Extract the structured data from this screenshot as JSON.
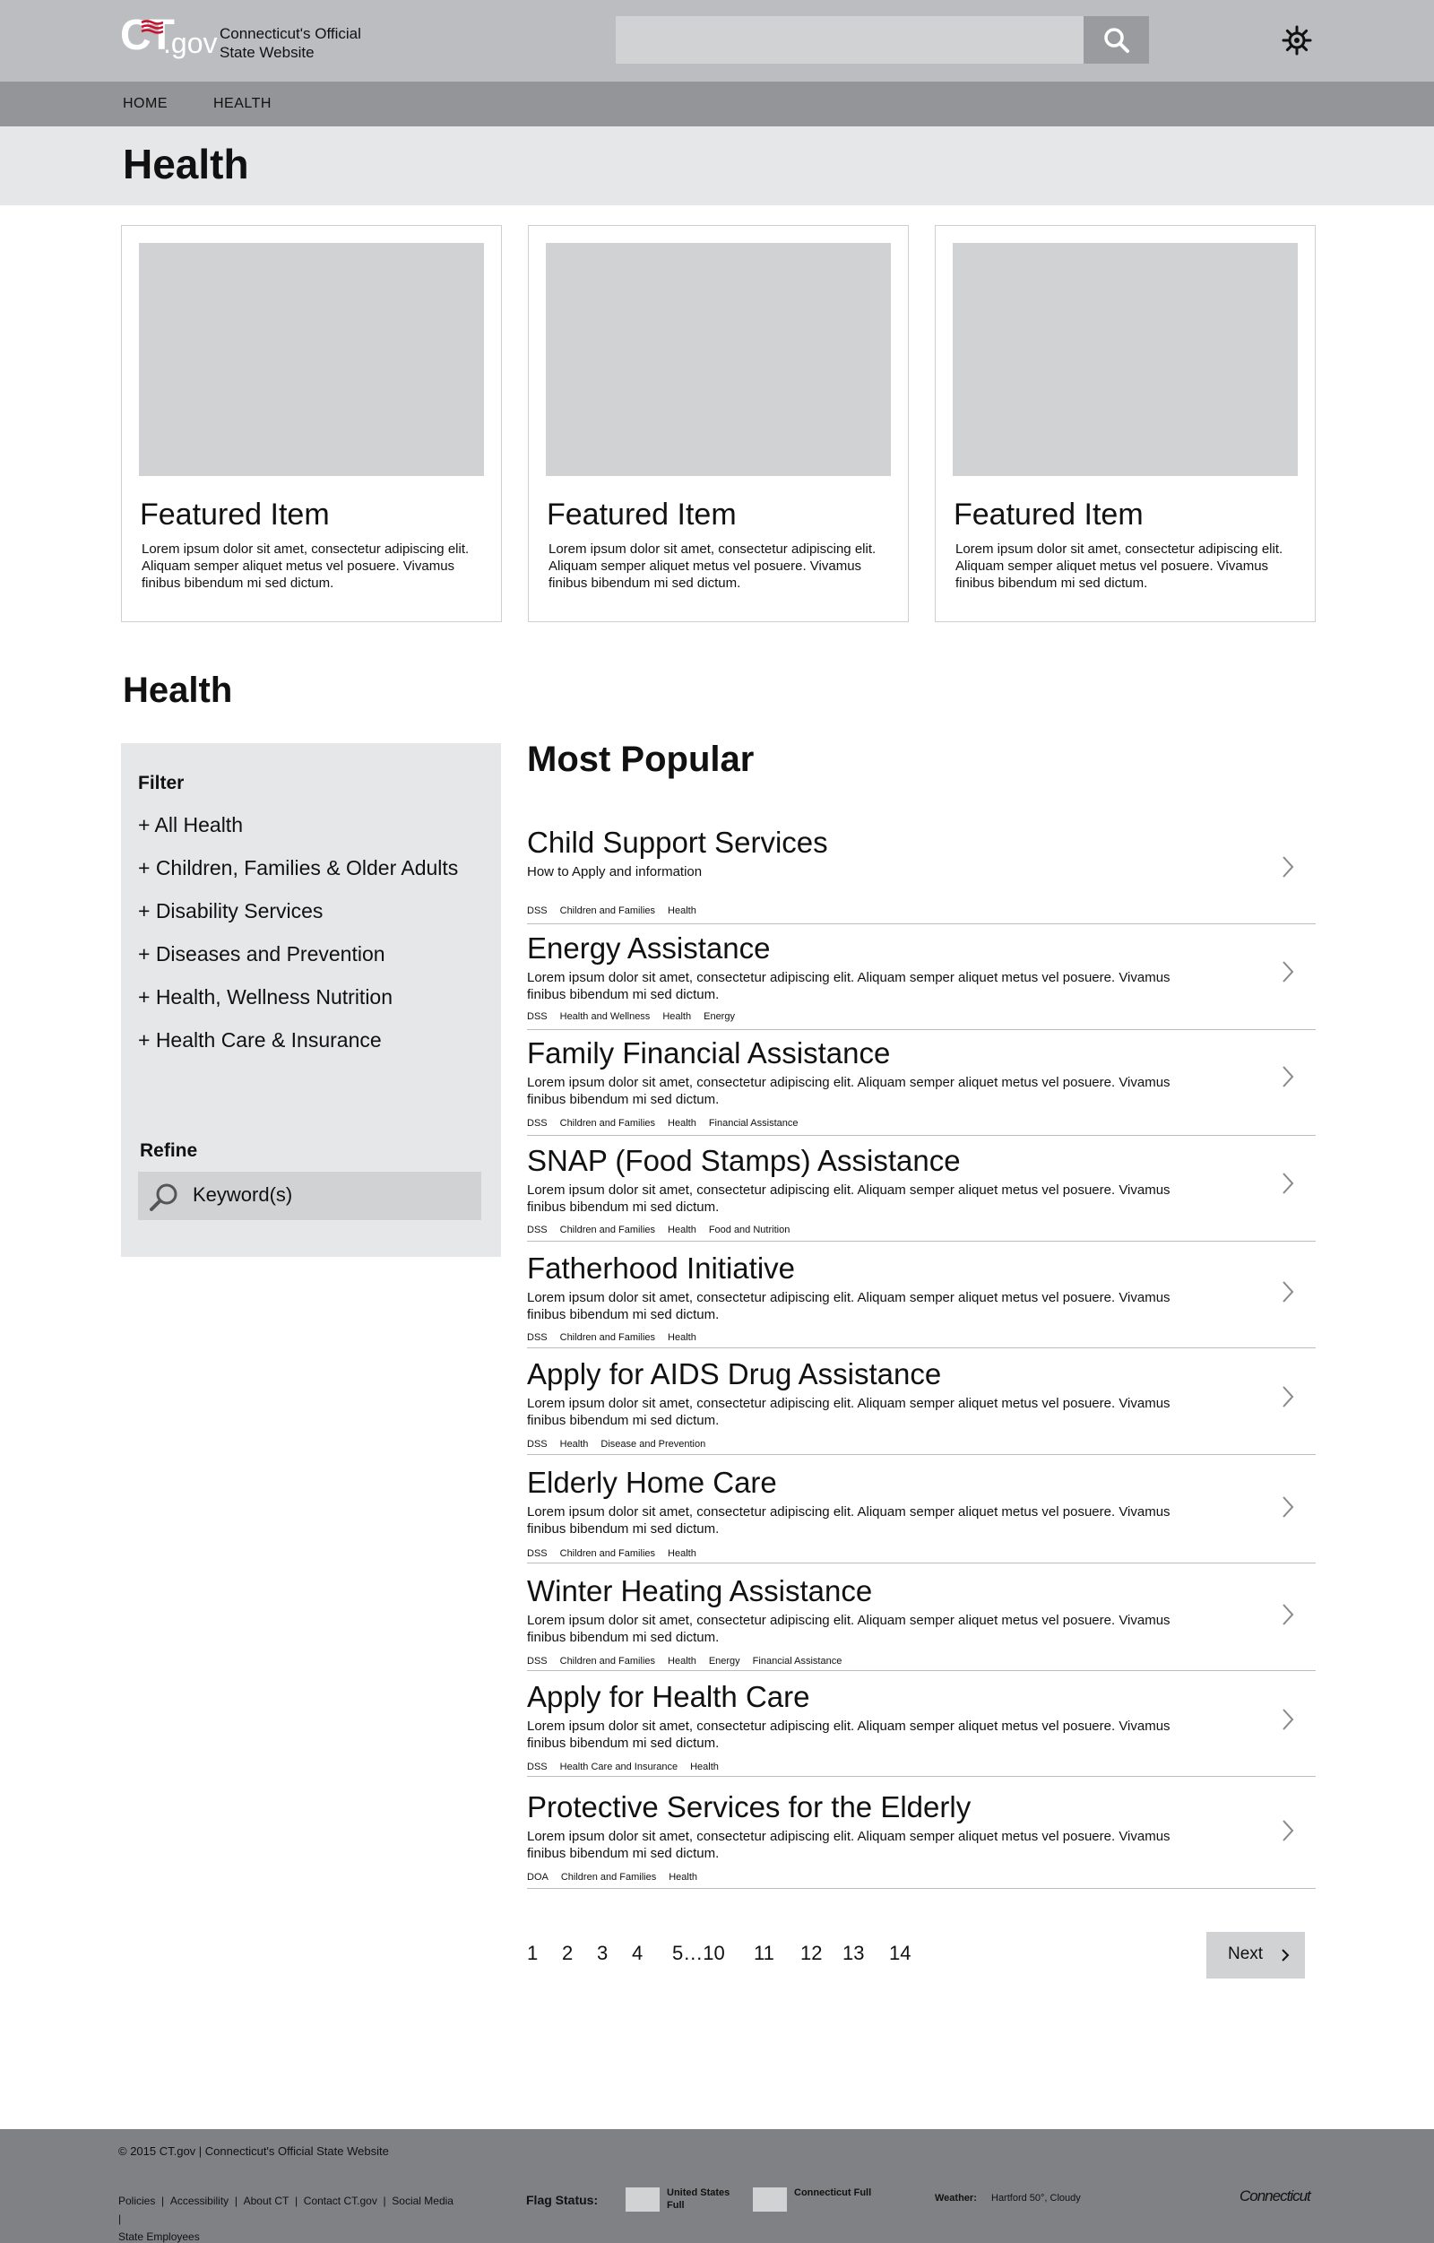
{
  "header": {
    "logo_ct": "CT",
    "logo_gov": ".gov",
    "site_title_line1": "Connecticut's Official",
    "site_title_line2": "State Website",
    "search_placeholder": ""
  },
  "nav": {
    "items": [
      "HOME",
      "HEALTH"
    ]
  },
  "page_title": "Health",
  "featured": [
    {
      "title": "Featured Item",
      "desc": "Lorem ipsum dolor sit amet, consectetur adipiscing elit. Aliquam semper aliquet metus vel posuere. Vivamus finibus bibendum mi sed dictum."
    },
    {
      "title": "Featured Item",
      "desc": "Lorem ipsum dolor sit amet, consectetur adipiscing elit. Aliquam semper aliquet metus vel posuere. Vivamus finibus bibendum mi sed dictum."
    },
    {
      "title": "Featured Item",
      "desc": "Lorem ipsum dolor sit amet, consectetur adipiscing elit. Aliquam semper aliquet metus vel posuere. Vivamus finibus bibendum mi sed dictum."
    }
  ],
  "section_title": "Health",
  "sidebar": {
    "filter_label": "Filter",
    "filters": [
      "+ All Health",
      "+ Children, Families & Older Adults",
      "+ Disability Services",
      "+ Diseases and Prevention",
      "+ Health, Wellness Nutrition",
      "+ Health Care & Insurance"
    ],
    "refine_label": "Refine",
    "keyword_placeholder": "Keyword(s)"
  },
  "most_popular": {
    "title": "Most Popular",
    "items": [
      {
        "title": "Child Support Services",
        "desc": "How to Apply and information",
        "tags": [
          "DSS",
          "Children and Families",
          "Health"
        ]
      },
      {
        "title": "Energy Assistance",
        "desc": "Lorem ipsum dolor sit amet, consectetur adipiscing elit. Aliquam semper aliquet metus vel posuere. Vivamus finibus bibendum mi sed dictum.",
        "tags": [
          "DSS",
          "Health and Wellness",
          "Health",
          "Energy"
        ]
      },
      {
        "title": "Family Financial Assistance",
        "desc": "Lorem ipsum dolor sit amet, consectetur adipiscing elit. Aliquam semper aliquet metus vel posuere. Vivamus finibus bibendum mi sed dictum.",
        "tags": [
          "DSS",
          "Children and Families",
          "Health",
          "Financial Assistance"
        ]
      },
      {
        "title": "SNAP (Food Stamps) Assistance",
        "desc": "Lorem ipsum dolor sit amet, consectetur adipiscing elit. Aliquam semper aliquet metus vel posuere. Vivamus finibus bibendum mi sed dictum.",
        "tags": [
          "DSS",
          "Children and Families",
          "Health",
          "Food and Nutrition"
        ]
      },
      {
        "title": "Fatherhood Initiative",
        "desc": "Lorem ipsum dolor sit amet, consectetur adipiscing elit. Aliquam semper aliquet metus vel posuere. Vivamus finibus bibendum mi sed dictum.",
        "tags": [
          "DSS",
          "Children and Families",
          "Health"
        ]
      },
      {
        "title": "Apply for AIDS Drug Assistance",
        "desc": "Lorem ipsum dolor sit amet, consectetur adipiscing elit. Aliquam semper aliquet metus vel posuere. Vivamus finibus bibendum mi sed dictum.",
        "tags": [
          "DSS",
          "Health",
          "Disease and Prevention"
        ]
      },
      {
        "title": "Elderly Home Care",
        "desc": "Lorem ipsum dolor sit amet, consectetur adipiscing elit. Aliquam semper aliquet metus vel posuere. Vivamus finibus bibendum mi sed dictum.",
        "tags": [
          "DSS",
          "Children and Families",
          "Health"
        ]
      },
      {
        "title": "Winter Heating Assistance",
        "desc": "Lorem ipsum dolor sit amet, consectetur adipiscing elit. Aliquam semper aliquet metus vel posuere. Vivamus finibus bibendum mi sed dictum.",
        "tags": [
          "DSS",
          "Children and Families",
          "Health",
          "Energy",
          "Financial Assistance"
        ]
      },
      {
        "title": "Apply for Health Care",
        "desc": "Lorem ipsum dolor sit amet, consectetur adipiscing elit. Aliquam semper aliquet metus vel posuere. Vivamus finibus bibendum mi sed dictum.",
        "tags": [
          "DSS",
          "Health Care and Insurance",
          "Health"
        ]
      },
      {
        "title": "Protective Services for the Elderly",
        "desc": "Lorem ipsum dolor sit amet, consectetur adipiscing elit. Aliquam semper aliquet metus vel posuere. Vivamus finibus bibendum mi sed dictum.",
        "tags": [
          "DOA",
          "Children and Families",
          "Health"
        ]
      }
    ]
  },
  "pagination": {
    "pages": [
      "1",
      "2",
      "3",
      "4",
      "5…10",
      "11",
      "12",
      "13",
      "14"
    ],
    "next_label": "Next"
  },
  "footer": {
    "copyright": "© 2015 CT.gov | Connecticut's Official State Website",
    "links": [
      "Policies",
      "Accessibility",
      "About CT",
      "Contact CT.gov",
      "Social Media",
      "State Employees"
    ],
    "flag_status_label": "Flag Status:",
    "flags": [
      {
        "name": "United States Full"
      },
      {
        "name": "Connecticut Full"
      }
    ],
    "weather_label": "Weather:",
    "weather_value": "Hartford 50°, Cloudy",
    "logo_text": "Connecticut"
  },
  "colors": {
    "header_bg": "#bcbdc0",
    "nav_bg": "#939598",
    "title_bar_bg": "#e6e7e8",
    "placeholder_gray": "#d1d2d4",
    "footer_bg": "#808184"
  }
}
